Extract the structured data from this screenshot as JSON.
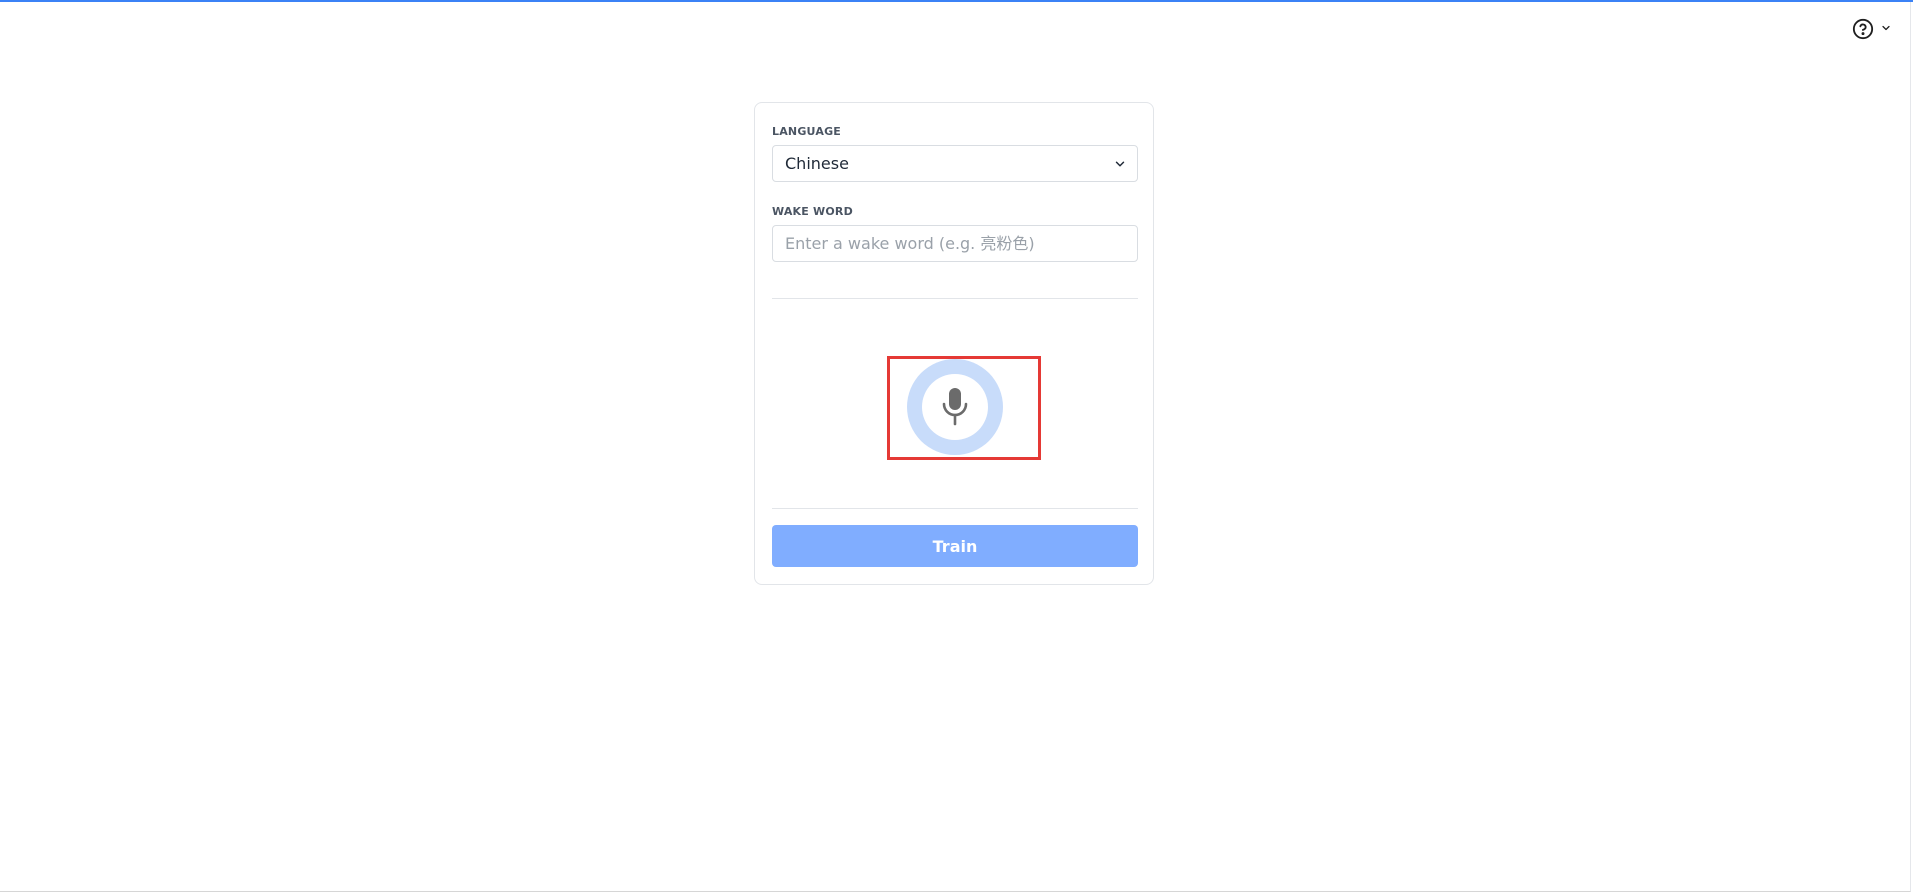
{
  "header": {
    "help_icon": "help-circle-icon",
    "caret_icon": "chevron-down-icon"
  },
  "form": {
    "language_label": "LANGUAGE",
    "language_value": "Chinese",
    "wake_word_label": "WAKE WORD",
    "wake_word_value": "",
    "wake_word_placeholder": "Enter a wake word (e.g. 亮粉色)",
    "mic_icon": "microphone-icon",
    "train_label": "Train"
  },
  "colors": {
    "accent": "#3b82f6",
    "train_button": "#80adff",
    "mic_ring": "#c8dcfa",
    "highlight": "#e53935"
  }
}
